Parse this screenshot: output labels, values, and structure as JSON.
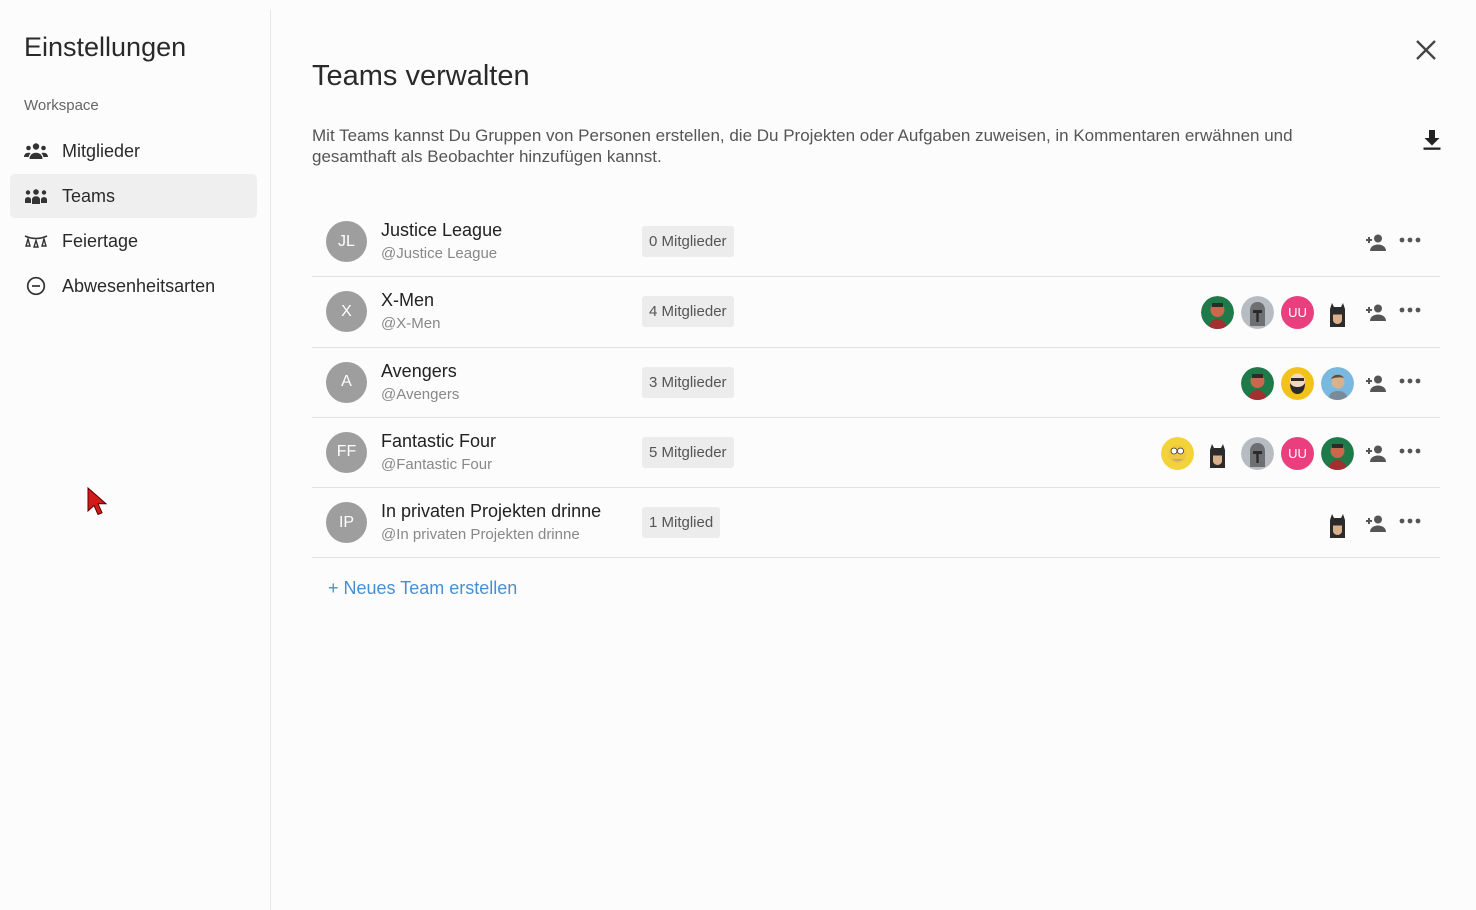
{
  "sidebar": {
    "title": "Einstellungen",
    "section": "Workspace",
    "items": [
      {
        "label": "Mitglieder",
        "icon": "people-icon"
      },
      {
        "label": "Teams",
        "icon": "teams-icon",
        "active": true
      },
      {
        "label": "Feiertage",
        "icon": "holiday-garland-icon"
      },
      {
        "label": "Abwesenheitsarten",
        "icon": "minus-circle-icon"
      }
    ]
  },
  "main": {
    "title": "Teams verwalten",
    "description": "Mit Teams kannst Du Gruppen von Personen erstellen, die Du Projekten oder Aufgaben zuweisen, in Kommentaren erwähnen und gesamthaft als Beobachter hinzufügen kannst.",
    "new_team_label": "+ Neues Team erstellen"
  },
  "teams": [
    {
      "initials": "JL",
      "name": "Justice League",
      "handle": "@Justice League",
      "members_label": "0 Mitglieder",
      "members": []
    },
    {
      "initials": "X",
      "name": "X-Men",
      "handle": "@X-Men",
      "members_label": "4 Mitglieder",
      "members": [
        "green-avatar",
        "knight-avatar",
        "UU",
        "batman-avatar"
      ]
    },
    {
      "initials": "A",
      "name": "Avengers",
      "handle": "@Avengers",
      "members_label": "3 Mitglieder",
      "members": [
        "green-avatar",
        "bearded-avatar",
        "blue-avatar"
      ]
    },
    {
      "initials": "FF",
      "name": "Fantastic Four",
      "handle": "@Fantastic Four",
      "members_label": "5 Mitglieder",
      "members": [
        "homer-avatar",
        "batman-avatar",
        "knight-avatar",
        "UU",
        "green-avatar"
      ]
    },
    {
      "initials": "IP",
      "name": "In privaten Projekten drinne",
      "handle": "@In privaten Projekten drinne",
      "members_label": "1 Mitglied",
      "members": [
        "batman-avatar"
      ]
    }
  ],
  "colors": {
    "accent_link": "#4a8ed2",
    "team_avatar_bg": "#9e9e9e",
    "uu_avatar_bg": "#ea3f7e",
    "active_nav_bg": "#efefef"
  }
}
